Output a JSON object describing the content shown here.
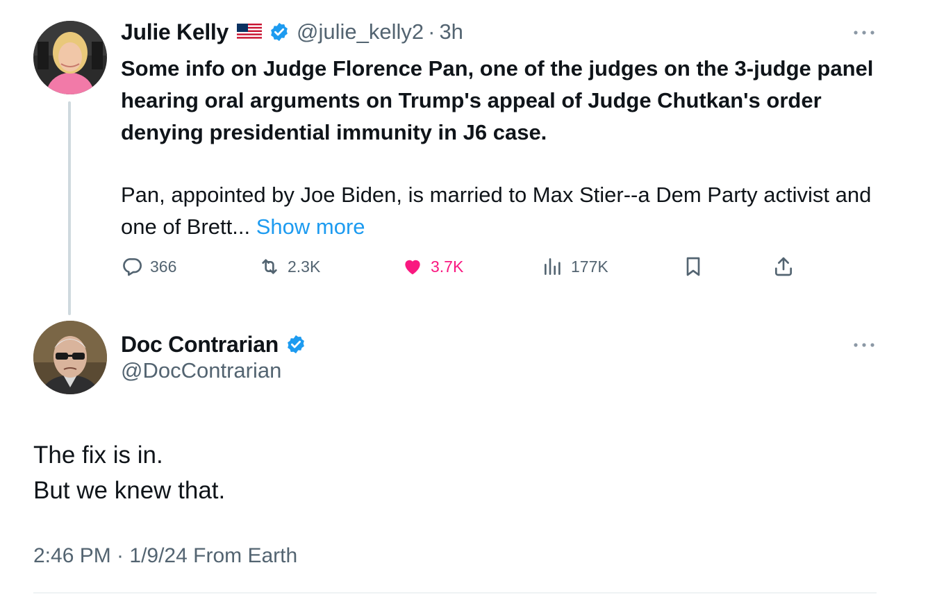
{
  "quoted_tweet": {
    "author_name": "Julie Kelly",
    "author_handle": "@julie_kelly2",
    "separator": "·",
    "time_ago": "3h",
    "flag_icon": "us-flag-icon",
    "verified_color": "#1d9bf0",
    "text_bold": "Some info on Judge Florence Pan, one of the judges on the 3-judge panel hearing oral arguments on Trump's appeal of Judge Chutkan's order denying presidential immunity in J6 case.",
    "text_normal": "Pan, appointed by Joe Biden, is married to Max Stier--a Dem Party activist and one of Brett...",
    "show_more": "Show more",
    "actions": {
      "replies": "366",
      "reposts": "2.3K",
      "likes": "3.7K",
      "views": "177K"
    },
    "like_color": "#f91880"
  },
  "reply_tweet": {
    "author_name": "Doc Contrarian",
    "author_handle": "@DocContrarian",
    "text_line1": "The fix is in.",
    "text_line2": "But we knew that.",
    "timestamp": "2:46 PM · 1/9/24 From Earth"
  },
  "colors": {
    "accent": "#1d9bf0",
    "secondary_text": "#536471",
    "primary_text": "#0f1419"
  }
}
